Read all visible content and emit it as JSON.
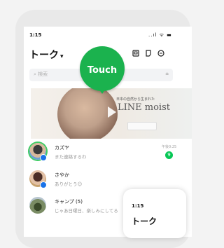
{
  "status_bar": {
    "time": "1:15",
    "icons": "..ıl ᯤ ▬"
  },
  "header": {
    "title": "トーク",
    "chevron": "▾"
  },
  "search": {
    "placeholder": "検索",
    "qr_icon": "⌗"
  },
  "banner": {
    "tagline": "日本の自然から生まれた",
    "brand": "LINE moist",
    "product_label": "LINE moist"
  },
  "chats": [
    {
      "name": "カズヤ",
      "message": "また連絡するわ",
      "time": "午後0:25",
      "unread": "9"
    },
    {
      "name": "さやか",
      "message": "ありがとう☺"
    },
    {
      "name": "キャンプ (5)",
      "message": "じゃあ日曜日、楽しみにしてる"
    }
  ],
  "overlay": {
    "touch_label": "Touch"
  },
  "second_screen": {
    "time": "1:15",
    "title": "トーク"
  },
  "colors": {
    "line_green": "#06c755",
    "touch_green": "#1bb24e",
    "badge_blue": "#1a73e8"
  }
}
